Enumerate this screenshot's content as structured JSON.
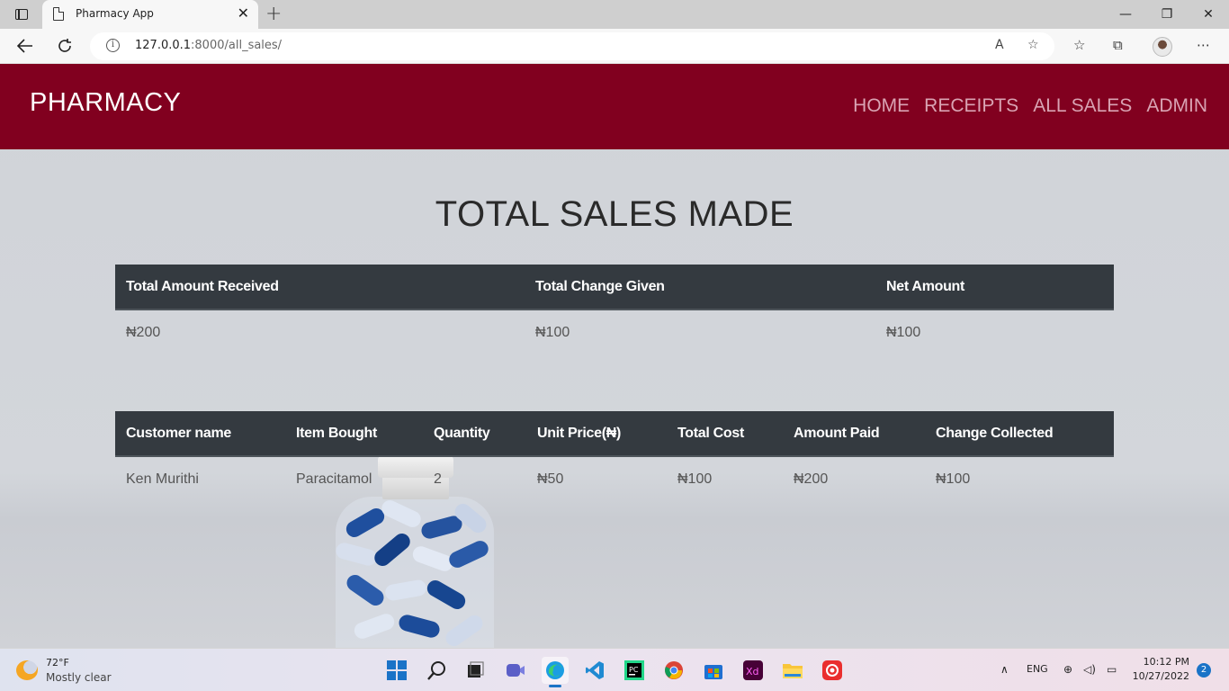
{
  "browser": {
    "tab_title": "Pharmacy App",
    "close_symbol": "✕",
    "new_tab_symbol": "+",
    "url_host": "127.0.0.1",
    "url_rest": ":8000/all_sales/",
    "window_controls": [
      "—",
      "❐",
      "✕"
    ]
  },
  "navbar": {
    "brand": "PHARMACY",
    "links": [
      "HOME",
      "RECEIPTS",
      "ALL SALES",
      "ADMIN"
    ],
    "bg_color": "#81001f"
  },
  "page": {
    "heading": "TOTAL SALES MADE"
  },
  "summary_table": {
    "headers": [
      "Total Amount Received",
      "Total Change Given",
      "Net Amount"
    ],
    "row": [
      "₦200",
      "₦100",
      "₦100"
    ]
  },
  "sales_table": {
    "headers": [
      "Customer name",
      "Item Bought",
      "Quantity",
      "Unit Price(₦)",
      "Total Cost",
      "Amount Paid",
      "Change Collected"
    ],
    "rows": [
      [
        "Ken Murithi",
        "Paracitamol",
        "2",
        "₦50",
        "₦100",
        "₦200",
        "₦100"
      ]
    ]
  },
  "taskbar": {
    "temperature": "72°F",
    "weather": "Mostly clear",
    "lang": "ENG",
    "time": "10:12 PM",
    "date": "10/27/2022",
    "notifications": "2"
  }
}
